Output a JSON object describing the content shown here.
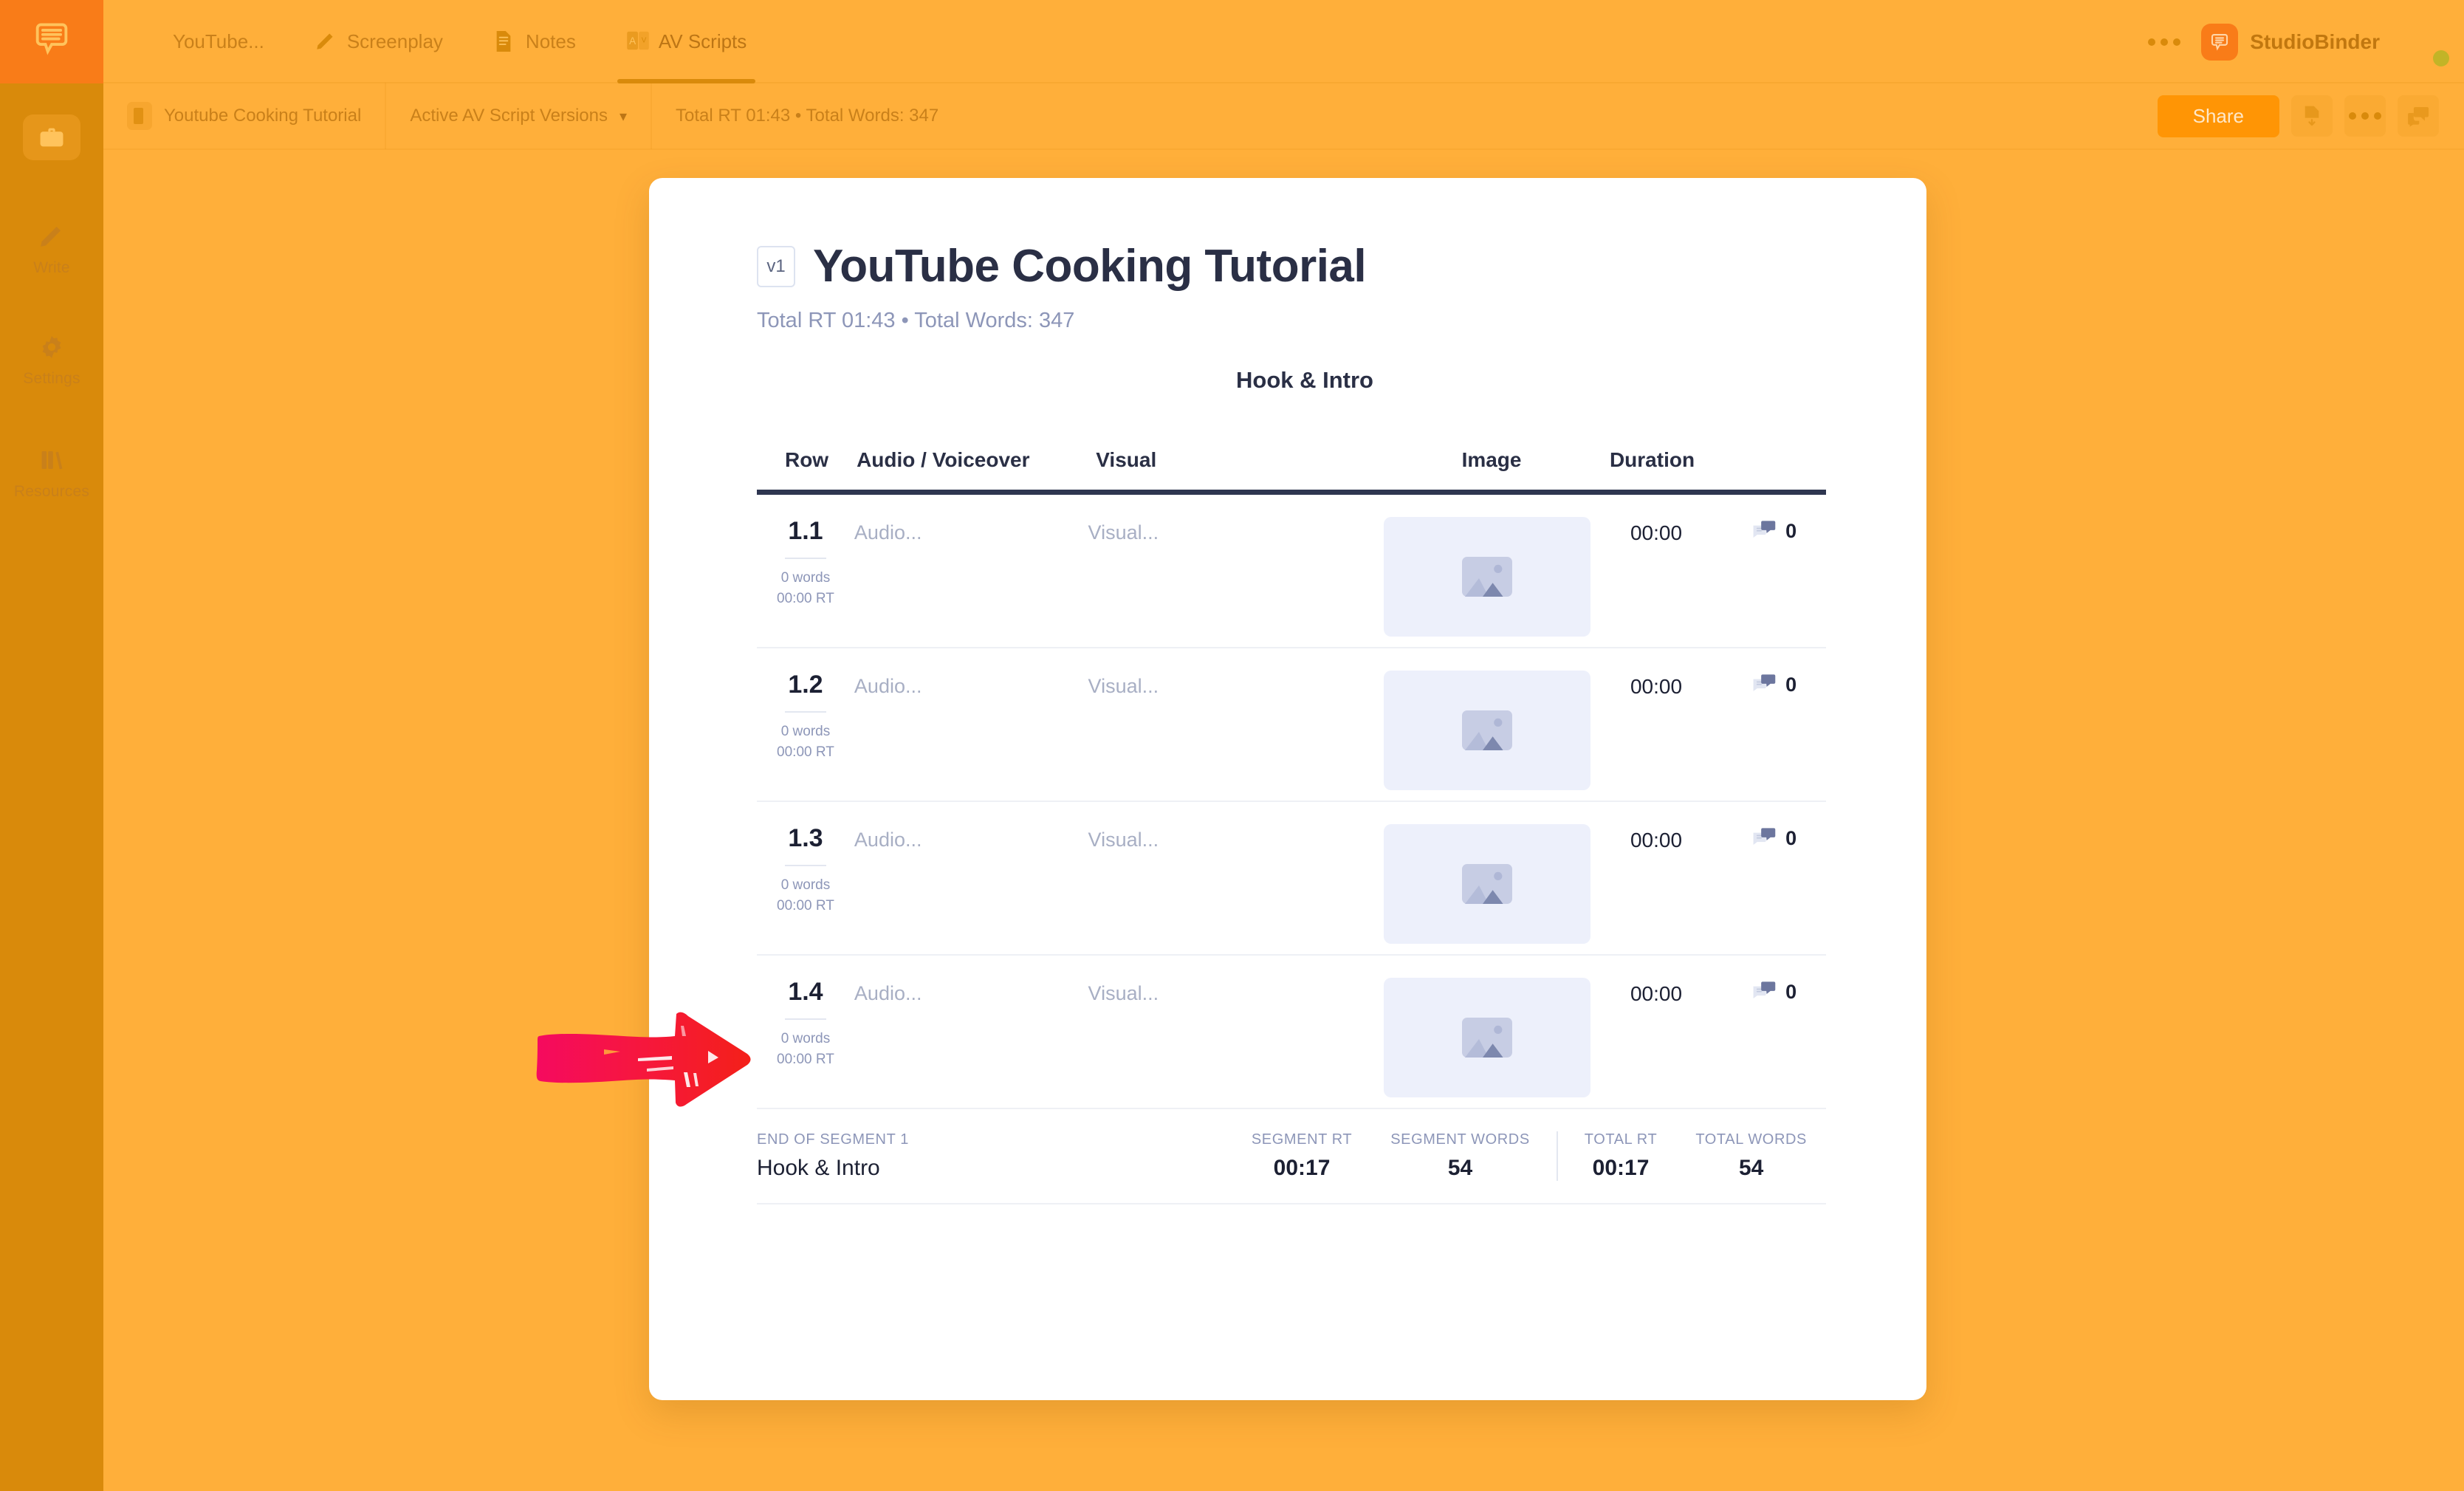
{
  "colors": {
    "bg_orange": "#FFAF3A",
    "rail_orange": "#D98A0B",
    "brand_orange": "#F97C18",
    "share_button": "#FF9505",
    "table_rule": "#2E3650",
    "muted_text": "#8D96B8",
    "dark_text": "#2A2F45",
    "arrow_red": "#F5222D",
    "arrow_pink": "#F60E5C"
  },
  "rail": {
    "logo_icon": "speech-bubble-logo-icon",
    "items": [
      {
        "icon": "briefcase-icon",
        "label": ""
      },
      {
        "icon": "pencil-icon",
        "label": "Write"
      },
      {
        "icon": "gear-icon",
        "label": "Settings"
      },
      {
        "icon": "books-icon",
        "label": "Resources"
      }
    ]
  },
  "topbar": {
    "tabs": [
      {
        "label": "YouTube...",
        "icon": "",
        "active": false
      },
      {
        "label": "Screenplay",
        "icon": "pencil-icon",
        "active": false
      },
      {
        "label": "Notes",
        "icon": "notes-document-icon",
        "active": false
      },
      {
        "label": "AV Scripts",
        "icon": "av-icon",
        "active": true
      }
    ],
    "overflow_icon": "ellipsis-icon",
    "brand_name": "StudioBinder",
    "brand_icon": "studiobinder-logo-icon",
    "avatar": "user-avatar"
  },
  "subbar": {
    "project_name": "Youtube Cooking Tutorial",
    "versions_label": "Active AV Script Versions",
    "versions_chevron": "chevron-down-icon",
    "stats": "Total RT 01:43 • Total Words: 347",
    "share_label": "Share",
    "actions": [
      {
        "icon": "download-pdf-icon"
      },
      {
        "icon": "ellipsis-icon"
      },
      {
        "icon": "comment-icon"
      }
    ]
  },
  "modal": {
    "version_badge": "v1",
    "title": "YouTube Cooking Tutorial",
    "meta": "Total RT 01:43 • Total Words: 347",
    "segment_heading": "Hook & Intro",
    "table": {
      "columns": [
        "Row",
        "Audio / Voiceover",
        "Visual",
        "Image",
        "Duration"
      ],
      "rows": [
        {
          "num": "1.1",
          "words": "0 words",
          "rt": "00:00 RT",
          "audio": "Audio...",
          "visual": "Visual...",
          "image_icon": "image-placeholder-icon",
          "duration": "00:00",
          "comment_icon": "comment-icon",
          "comments": "0"
        },
        {
          "num": "1.2",
          "words": "0 words",
          "rt": "00:00 RT",
          "audio": "Audio...",
          "visual": "Visual...",
          "image_icon": "image-placeholder-icon",
          "duration": "00:00",
          "comment_icon": "comment-icon",
          "comments": "0"
        },
        {
          "num": "1.3",
          "words": "0 words",
          "rt": "00:00 RT",
          "audio": "Audio...",
          "visual": "Visual...",
          "image_icon": "image-placeholder-icon",
          "duration": "00:00",
          "comment_icon": "comment-icon",
          "comments": "0"
        },
        {
          "num": "1.4",
          "words": "0 words",
          "rt": "00:00 RT",
          "audio": "Audio...",
          "visual": "Visual...",
          "image_icon": "image-placeholder-icon",
          "duration": "00:00",
          "comment_icon": "comment-icon",
          "comments": "0"
        }
      ],
      "footer": {
        "end_label": "END OF SEGMENT 1",
        "end_value": "Hook & Intro",
        "segment_rt_label": "SEGMENT RT",
        "segment_rt_value": "00:17",
        "segment_words_label": "SEGMENT WORDS",
        "segment_words_value": "54",
        "total_rt_label": "TOTAL RT",
        "total_rt_value": "00:17",
        "total_words_label": "TOTAL WORDS",
        "total_words_value": "54"
      }
    }
  },
  "annotation": {
    "arrow": "red-arrow-pointing-right"
  }
}
